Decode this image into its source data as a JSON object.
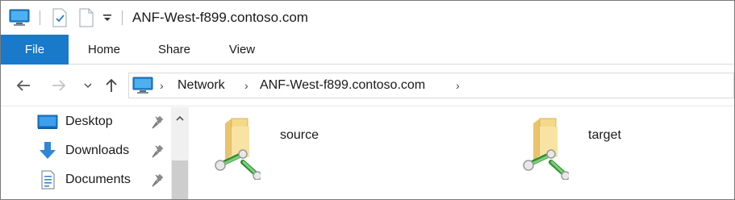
{
  "window": {
    "title": "ANF-West-f899.contoso.com"
  },
  "quick_access_toolbar": {
    "icons": [
      "computer-icon",
      "properties-icon",
      "new-folder-icon",
      "customize-dropdown-icon"
    ]
  },
  "ribbon": {
    "tabs": [
      {
        "label": "File",
        "active": true
      },
      {
        "label": "Home"
      },
      {
        "label": "Share"
      },
      {
        "label": "View"
      }
    ],
    "accent_color": "#1979ca"
  },
  "navigation": {
    "back_icon": "arrow-left-icon",
    "forward_icon": "arrow-right-icon",
    "recent_icon": "chevron-down-icon",
    "up_icon": "arrow-up-icon"
  },
  "address_bar": {
    "breadcrumbs": [
      {
        "label": "Network"
      },
      {
        "label": "ANF-West-f899.contoso.com"
      }
    ]
  },
  "nav_pane": {
    "items": [
      {
        "label": "Desktop",
        "icon": "desktop-icon",
        "pinned": true
      },
      {
        "label": "Downloads",
        "icon": "downloads-icon",
        "pinned": true
      },
      {
        "label": "Documents",
        "icon": "documents-icon",
        "pinned": true
      }
    ]
  },
  "content": {
    "items": [
      {
        "label": "source",
        "icon": "network-share-folder-icon"
      },
      {
        "label": "target",
        "icon": "network-share-folder-icon"
      }
    ]
  }
}
